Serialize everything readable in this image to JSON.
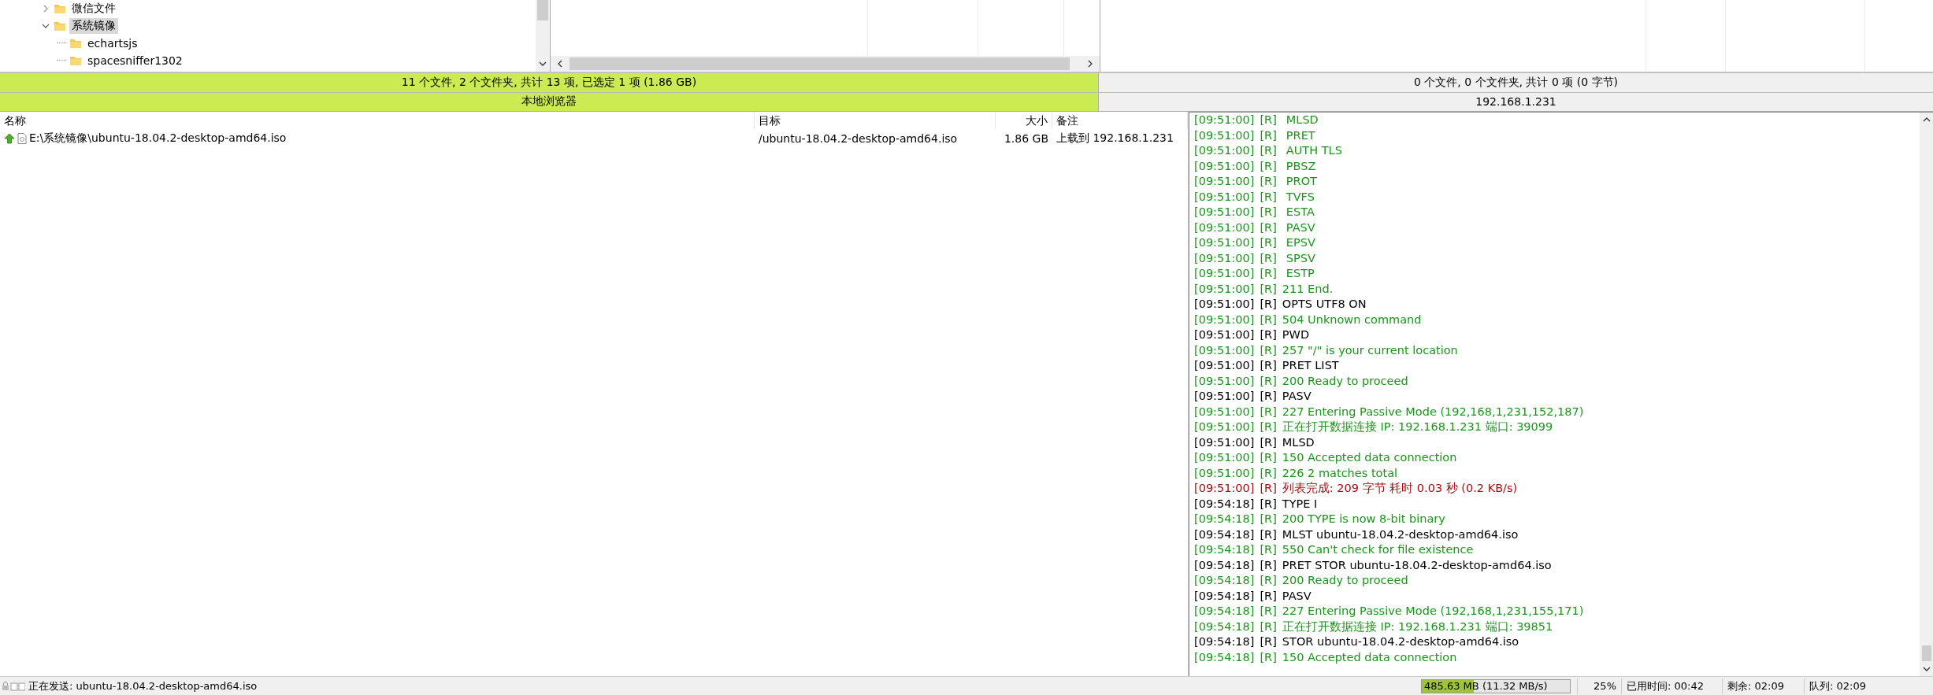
{
  "local_tree": {
    "items": [
      {
        "label": "微信文件",
        "expanded": false,
        "selected": false
      },
      {
        "label": "系统镜像",
        "expanded": true,
        "selected": true,
        "children": [
          {
            "label": "echartsjs",
            "selected": false
          },
          {
            "label": "spacesniffer1302",
            "selected": false
          }
        ]
      }
    ]
  },
  "local_status": {
    "summary": "11 个文件, 2 个文件夹, 共计 13 项, 已选定 1 项 (1.86 GB)",
    "title": "本地浏览器"
  },
  "remote_status": {
    "summary": "0 个文件, 0 个文件夹, 共计 0 项 (0 字节)",
    "title": "192.168.1.231"
  },
  "queue": {
    "columns": [
      "名称",
      "目标",
      "大小",
      "备注"
    ],
    "rows": [
      {
        "kind": "upload",
        "name": "E:\\系统镜像\\ubuntu-18.04.2-desktop-amd64.iso",
        "target": "/ubuntu-18.04.2-desktop-amd64.iso",
        "size": "1.86 GB",
        "note": "上载到 192.168.1.231"
      }
    ]
  },
  "log": {
    "lines": [
      {
        "time": "[09:51:00]",
        "source": "[R]",
        "text": "MLSD",
        "kind": "feature"
      },
      {
        "time": "[09:51:00]",
        "source": "[R]",
        "text": "PRET",
        "kind": "feature"
      },
      {
        "time": "[09:51:00]",
        "source": "[R]",
        "text": "AUTH TLS",
        "kind": "feature"
      },
      {
        "time": "[09:51:00]",
        "source": "[R]",
        "text": "PBSZ",
        "kind": "feature"
      },
      {
        "time": "[09:51:00]",
        "source": "[R]",
        "text": "PROT",
        "kind": "feature"
      },
      {
        "time": "[09:51:00]",
        "source": "[R]",
        "text": "TVFS",
        "kind": "feature"
      },
      {
        "time": "[09:51:00]",
        "source": "[R]",
        "text": "ESTA",
        "kind": "feature"
      },
      {
        "time": "[09:51:00]",
        "source": "[R]",
        "text": "PASV",
        "kind": "feature"
      },
      {
        "time": "[09:51:00]",
        "source": "[R]",
        "text": "EPSV",
        "kind": "feature"
      },
      {
        "time": "[09:51:00]",
        "source": "[R]",
        "text": "SPSV",
        "kind": "feature"
      },
      {
        "time": "[09:51:00]",
        "source": "[R]",
        "text": "ESTP",
        "kind": "feature"
      },
      {
        "time": "[09:51:00]",
        "source": "[R]",
        "text": "211 End.",
        "kind": "reply"
      },
      {
        "time": "[09:51:00]",
        "source": "[R]",
        "text": "OPTS UTF8 ON",
        "kind": "command"
      },
      {
        "time": "[09:51:00]",
        "source": "[R]",
        "text": "504 Unknown command",
        "kind": "reply"
      },
      {
        "time": "[09:51:00]",
        "source": "[R]",
        "text": "PWD",
        "kind": "command"
      },
      {
        "time": "[09:51:00]",
        "source": "[R]",
        "text": "257 \"/\" is your current location",
        "kind": "reply"
      },
      {
        "time": "[09:51:00]",
        "source": "[R]",
        "text": "PRET LIST",
        "kind": "command"
      },
      {
        "time": "[09:51:00]",
        "source": "[R]",
        "text": "200 Ready to proceed",
        "kind": "reply"
      },
      {
        "time": "[09:51:00]",
        "source": "[R]",
        "text": "PASV",
        "kind": "command"
      },
      {
        "time": "[09:51:00]",
        "source": "[R]",
        "text": "227 Entering Passive Mode (192,168,1,231,152,187)",
        "kind": "reply"
      },
      {
        "time": "[09:51:00]",
        "source": "[R]",
        "text": "正在打开数据连接 IP: 192.168.1.231 端口: 39099",
        "kind": "reply"
      },
      {
        "time": "[09:51:00]",
        "source": "[R]",
        "text": "MLSD",
        "kind": "command"
      },
      {
        "time": "[09:51:00]",
        "source": "[R]",
        "text": "150 Accepted data connection",
        "kind": "reply"
      },
      {
        "time": "[09:51:00]",
        "source": "[R]",
        "text": "226 2 matches total",
        "kind": "reply"
      },
      {
        "time": "[09:51:00]",
        "source": "[R]",
        "text": "列表完成: 209 字节 耗时 0.03 秒 (0.2 KB/s)",
        "kind": "result"
      },
      {
        "time": "[09:54:18]",
        "source": "[R]",
        "text": "TYPE I",
        "kind": "command"
      },
      {
        "time": "[09:54:18]",
        "source": "[R]",
        "text": "200 TYPE is now 8-bit binary",
        "kind": "reply"
      },
      {
        "time": "[09:54:18]",
        "source": "[R]",
        "text": "MLST ubuntu-18.04.2-desktop-amd64.iso",
        "kind": "command"
      },
      {
        "time": "[09:54:18]",
        "source": "[R]",
        "text": "550 Can't check for file existence",
        "kind": "reply"
      },
      {
        "time": "[09:54:18]",
        "source": "[R]",
        "text": "PRET STOR ubuntu-18.04.2-desktop-amd64.iso",
        "kind": "command"
      },
      {
        "time": "[09:54:18]",
        "source": "[R]",
        "text": "200 Ready to proceed",
        "kind": "reply"
      },
      {
        "time": "[09:54:18]",
        "source": "[R]",
        "text": "PASV",
        "kind": "command"
      },
      {
        "time": "[09:54:18]",
        "source": "[R]",
        "text": "227 Entering Passive Mode (192,168,1,231,155,171)",
        "kind": "reply"
      },
      {
        "time": "[09:54:18]",
        "source": "[R]",
        "text": "正在打开数据连接 IP: 192.168.1.231 端口: 39851",
        "kind": "reply"
      },
      {
        "time": "[09:54:18]",
        "source": "[R]",
        "text": "STOR ubuntu-18.04.2-desktop-amd64.iso",
        "kind": "command"
      },
      {
        "time": "[09:54:18]",
        "source": "[R]",
        "text": "150 Accepted data connection",
        "kind": "reply"
      }
    ]
  },
  "status_bar": {
    "action": "正在发送: ubuntu-18.04.2-desktop-amd64.iso",
    "progress": {
      "text": "485.63 MB (11.32 MB/s)",
      "level": 0.35
    },
    "percent": "25%",
    "elapsed": "已用时间: 00:42",
    "remaining": "剩余: 02:09",
    "queue": "队列: 02:09"
  }
}
